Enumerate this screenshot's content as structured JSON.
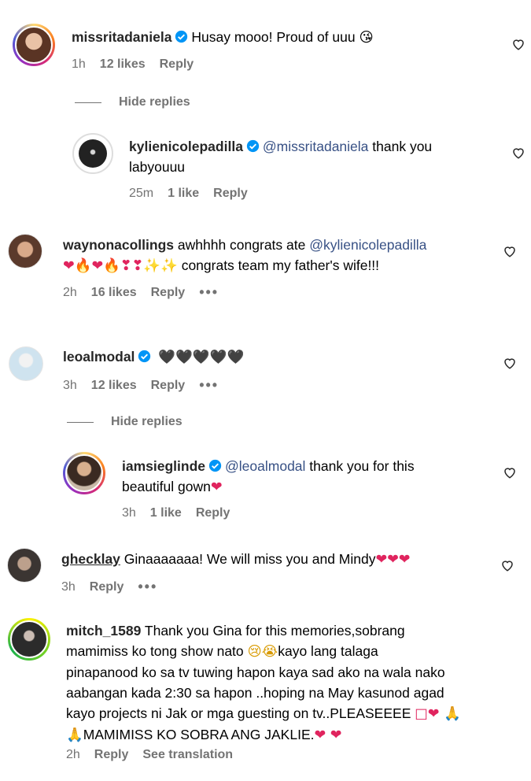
{
  "comments": [
    {
      "username": "missritadaniela",
      "text": "Husay mooo! Proud of uuu",
      "emoji": "😘",
      "time": "1h",
      "likes": "12 likes",
      "reply": "Reply",
      "hide_replies": "Hide replies",
      "replies": [
        {
          "username": "kylienicolepadilla",
          "mention": "@missritadaniela",
          "text_line1": "thank you",
          "text_line2": "labyouuu",
          "time": "25m",
          "likes": "1 like",
          "reply": "Reply"
        }
      ]
    },
    {
      "username": "waynonacollings",
      "text": "awhhhh congrats ate",
      "mention": "@kylienicolepadilla",
      "emoji_line": "❤🔥❤🔥❣❣✨✨",
      "text_line2": "congrats team my father's wife!!!",
      "time": "2h",
      "likes": "16 likes",
      "reply": "Reply",
      "more": "•••"
    },
    {
      "username": "leoalmodal",
      "emoji": "🖤🖤🖤🖤🖤",
      "time": "3h",
      "likes": "12 likes",
      "reply": "Reply",
      "more": "•••",
      "hide_replies": "Hide replies",
      "replies": [
        {
          "username": "iamsieglinde",
          "mention": "@leoalmodal",
          "text_line1": "thank you for this",
          "text_line2": "beautiful gown",
          "emoji": "❤",
          "time": "3h",
          "likes": "1 like",
          "reply": "Reply"
        }
      ]
    },
    {
      "username": "gheckl­ay",
      "text": "Ginaaaaaaa! We will miss you and Mindy",
      "emoji": "❤❤❤",
      "time": "3h",
      "reply": "Reply",
      "more": "•••"
    },
    {
      "username": "mitch_1589",
      "line1": "Thank you Gina for this memories,sobrang",
      "line2a": "mamimiss ko tong show nato",
      "line2emoji": "😢😭",
      "line2b": "kayo lang talaga",
      "line3": "pinapanood ko sa tv tuwing hapon kaya sad ako na wala nako",
      "line4": "aabangan kada 2:30 sa hapon ..hoping na May kasunod agad",
      "line5": "kayo projects ni Jak or mga guesting on tv..PLEASEEEE",
      "line5emoji": "□❤ 🙏",
      "line6emoji": "🙏",
      "line6": "MAMIMISS KO SOBRA ANG JAKLIE.",
      "line6end": "❤ ❤",
      "time": "2h",
      "reply": "Reply",
      "see_translation": "See translation"
    }
  ],
  "colors": {
    "secondary": "#737373",
    "mention": "#385185",
    "verified": "#0095f6"
  }
}
